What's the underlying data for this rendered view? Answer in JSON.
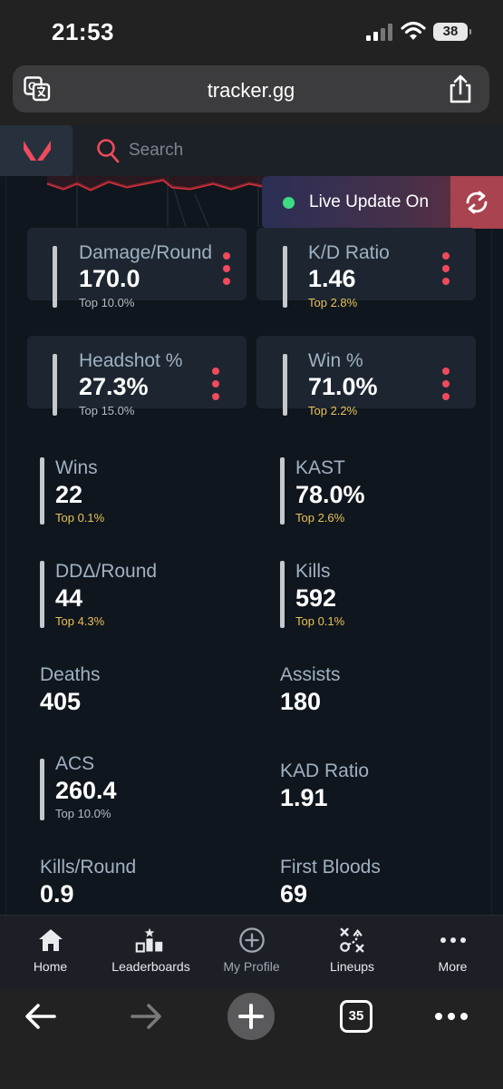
{
  "status_bar": {
    "time": "21:53",
    "battery": "38"
  },
  "browser": {
    "url": "tracker.gg",
    "tabs_count": "35"
  },
  "site": {
    "search": {
      "placeholder": "Search"
    },
    "live_update": {
      "label": "Live Update On"
    }
  },
  "featured_stats": [
    {
      "label": "Damage/Round",
      "value": "170.0",
      "rank": "Top 10.0%",
      "rank_color": "#b3bcc6"
    },
    {
      "label": "K/D Ratio",
      "value": "1.46",
      "rank": "Top 2.8%",
      "rank_color": "#e7c25b"
    },
    {
      "label": "Headshot %",
      "value": "27.3%",
      "rank": "Top 15.0%",
      "rank_color": "#b3bcc6"
    },
    {
      "label": "Win %",
      "value": "71.0%",
      "rank": "Top 2.2%",
      "rank_color": "#e7c25b"
    }
  ],
  "stats": [
    {
      "label": "Wins",
      "value": "22",
      "rank": "Top 0.1%"
    },
    {
      "label": "KAST",
      "value": "78.0%",
      "rank": "Top 2.6%"
    },
    {
      "label": "DDΔ/Round",
      "value": "44",
      "rank": "Top 4.3%"
    },
    {
      "label": "Kills",
      "value": "592",
      "rank": "Top 0.1%"
    },
    {
      "label": "Deaths",
      "value": "405"
    },
    {
      "label": "Assists",
      "value": "180"
    },
    {
      "label": "ACS",
      "value": "260.4",
      "rank": "Top 10.0%"
    },
    {
      "label": "KAD Ratio",
      "value": "1.91"
    },
    {
      "label": "Kills/Round",
      "value": "0.9"
    },
    {
      "label": "First Bloods",
      "value": "69"
    }
  ],
  "tab_bar": [
    {
      "label": "Home",
      "icon": "home-icon"
    },
    {
      "label": "Leaderboards",
      "icon": "leaderboards-icon"
    },
    {
      "label": "My Profile",
      "icon": "plus-circle-icon"
    },
    {
      "label": "Lineups",
      "icon": "lineups-icon"
    },
    {
      "label": "More",
      "icon": "more-dots-icon"
    }
  ],
  "colors": {
    "accent": "#ef4a5d",
    "gold_rank": "#e7c25b",
    "live_dot": "#3ddc84",
    "background": "#10161d",
    "card": "#1d2630"
  }
}
